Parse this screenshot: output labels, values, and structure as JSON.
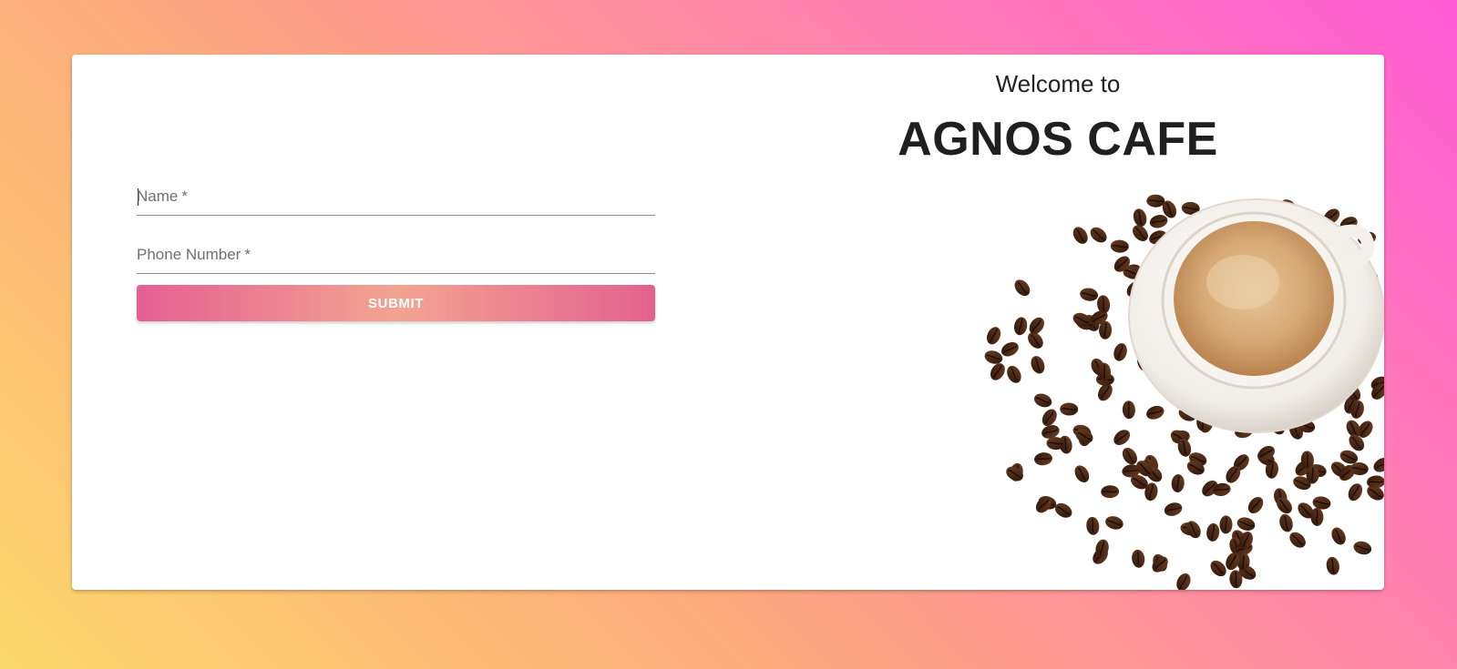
{
  "form": {
    "name_label": "Name",
    "phone_label": "Phone Number",
    "required_mark": "*",
    "name_value": "",
    "phone_value": "",
    "submit_label": "SUBMIT"
  },
  "hero": {
    "welcome": "Welcome to",
    "brand": "AGNOS CAFE",
    "image": "coffee-cup-with-beans"
  },
  "colors": {
    "bg_gradient": [
      "#fcd86b",
      "#fca87e",
      "#ff7fb1",
      "#ff5bd6"
    ],
    "button_gradient": [
      "#e45f93",
      "#f3a491",
      "#e2618f"
    ]
  }
}
